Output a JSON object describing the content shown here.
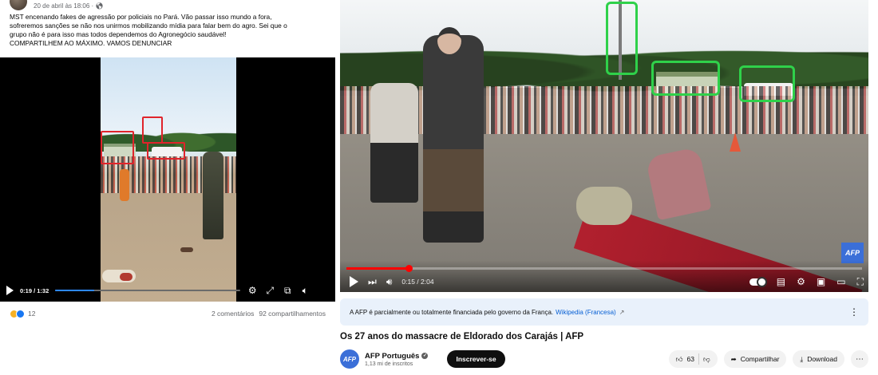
{
  "facebook": {
    "date": "20 de abril às 18:06 · ",
    "globe_icon": "globe-icon",
    "post_text_line1": "MST encenando fakes de agressão por policiais no Pará. Vão passar isso mundo a fora,",
    "post_text_line2": "sofreremos sanções se não nos unirmos mobilizando mídia para falar bem do agro. Sei que o",
    "post_text_line3": "grupo não é para isso mas todos dependemos do Agronegócio saudável!",
    "post_text_line4": "COMPARTILHEM AO MÁXIMO. VAMOS DENUNCIAR",
    "player": {
      "time": "0:19 / 1:32",
      "progress_fraction": 0.21,
      "icons": [
        "play-icon",
        "gear-icon",
        "fullscreen-icon",
        "pip-icon",
        "volume-icon"
      ]
    },
    "reactions_count": "12",
    "comments": "2 comentários",
    "shares": "92 compartilhamentos",
    "highlight_color": "#e0242b"
  },
  "youtube": {
    "player": {
      "time": "0:15 / 2:04",
      "progress_fraction": 0.12,
      "watermark": "AFP",
      "icons": [
        "play-icon",
        "next-icon",
        "volume-icon",
        "autoplay-toggle",
        "subtitles-icon",
        "gear-icon",
        "miniplayer-icon",
        "theater-icon",
        "fullscreen-icon"
      ]
    },
    "info_panel": {
      "text": "A AFP é parcialmente ou totalmente financiada pelo governo da França.",
      "link": "Wikipedia (Francesa)"
    },
    "title": "Os 27 anos do massacre de Eldorado dos Carajás | AFP",
    "channel": {
      "avatar_text": "AFP",
      "name": "AFP Português",
      "subscribers": "1,13 mi de inscritos",
      "subscribe_label": "Inscrever-se"
    },
    "actions": {
      "likes": "63",
      "share": "Compartilhar",
      "download": "Download"
    },
    "highlight_color": "#2fd14a",
    "accent": "#ff0000"
  }
}
